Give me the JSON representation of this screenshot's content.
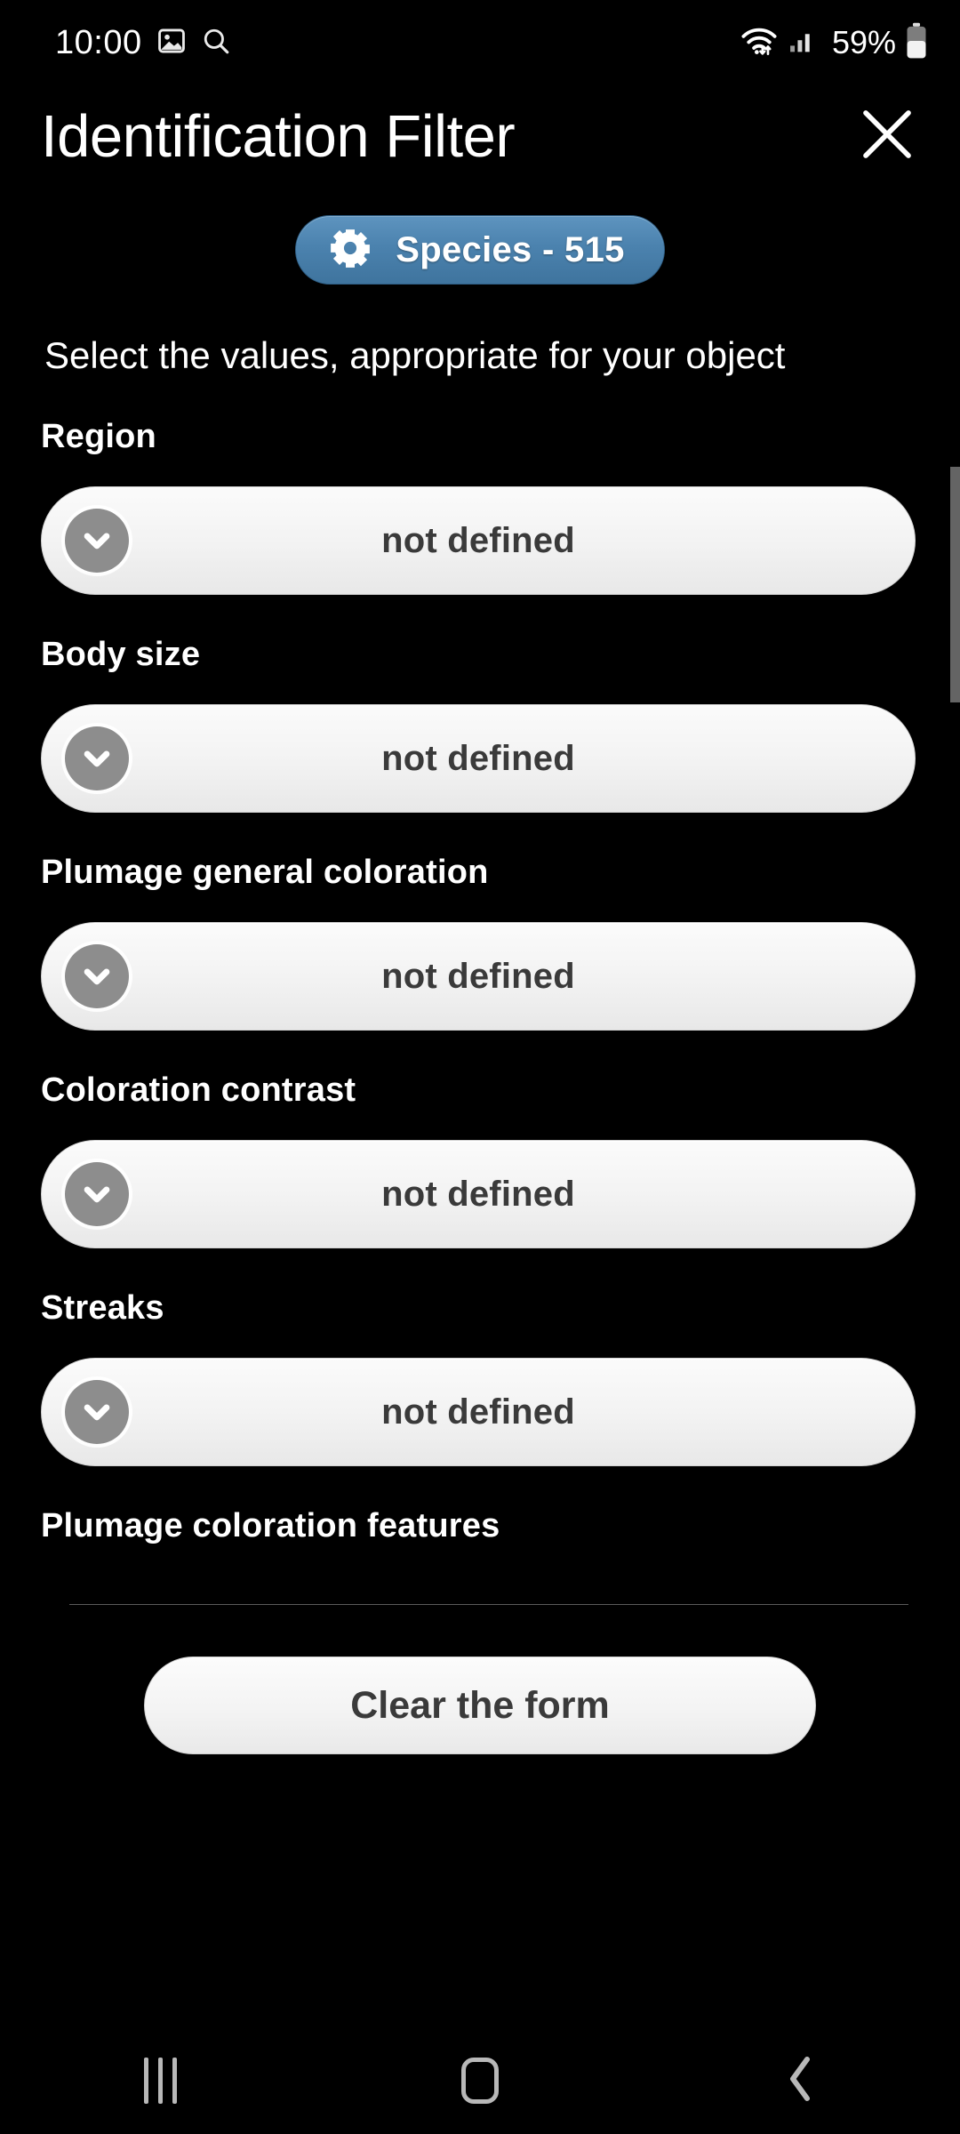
{
  "status_bar": {
    "time": "10:00",
    "icons_left": [
      "image-icon",
      "search-icon"
    ],
    "icons_right": [
      "wifi-icon",
      "cellular-signal-icon",
      "battery-icon"
    ],
    "battery_percent": "59%"
  },
  "header": {
    "title": "Identification Filter",
    "close_icon": "close-icon"
  },
  "badge": {
    "icon": "gear-icon",
    "label": "Species - 515",
    "color": "#4b82ae"
  },
  "subtitle": "Select the values, appropriate for your object",
  "fields": [
    {
      "label": "Region",
      "value": "not defined",
      "icon": "chevron-down-icon"
    },
    {
      "label": "Body size",
      "value": "not defined",
      "icon": "chevron-down-icon"
    },
    {
      "label": "Plumage general coloration",
      "value": "not defined",
      "icon": "chevron-down-icon"
    },
    {
      "label": "Coloration contrast",
      "value": "not defined",
      "icon": "chevron-down-icon"
    },
    {
      "label": "Streaks",
      "value": "not defined",
      "icon": "chevron-down-icon"
    },
    {
      "label": "Plumage coloration features"
    }
  ],
  "actions": {
    "clear_form": "Clear the form"
  },
  "nav_bar": {
    "recents": "recents-icon",
    "home": "home-icon",
    "back": "back-icon"
  }
}
